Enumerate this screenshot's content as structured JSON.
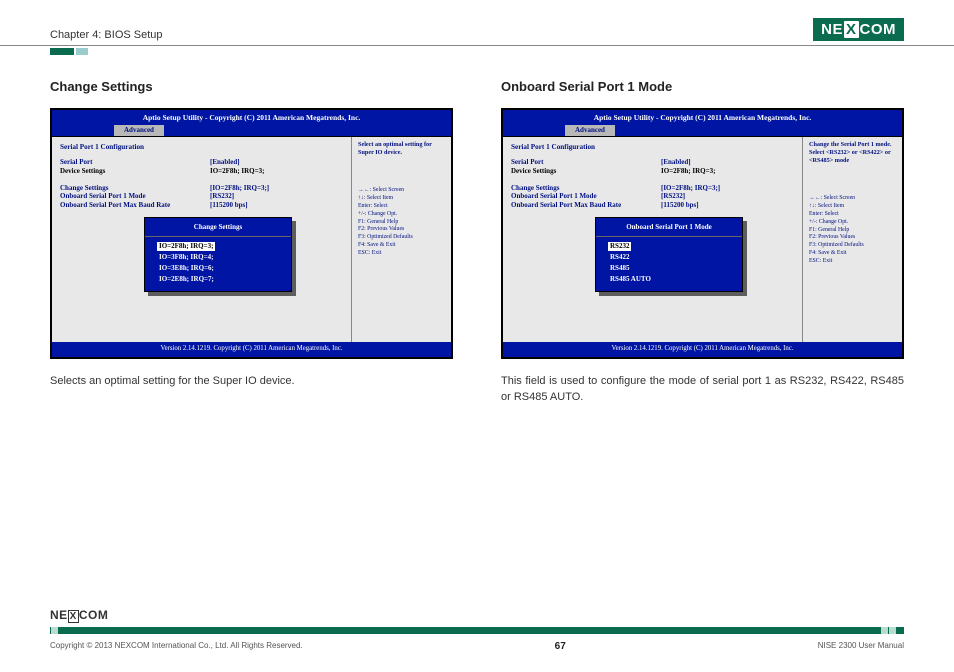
{
  "header": {
    "chapter": "Chapter 4: BIOS Setup",
    "logo_text_pre": "NE",
    "logo_text_x": "X",
    "logo_text_post": "COM"
  },
  "left": {
    "heading": "Change Settings",
    "bios": {
      "title": "Aptio Setup Utility - Copyright (C) 2011 American Megatrends, Inc.",
      "tab": "Advanced",
      "config_header": "Serial Port 1 Configuration",
      "rows": [
        {
          "label": "Serial Port",
          "value": "[Enabled]",
          "cls": "blue"
        },
        {
          "label": "Device Settings",
          "value": "IO=2F8h; IRQ=3;",
          "cls": "black"
        }
      ],
      "rows2": [
        {
          "label": "Change Settings",
          "value": "[IO=2F8h; IRQ=3;]",
          "cls": "blue"
        },
        {
          "label": "Onboard Serial Port 1 Mode",
          "value": "[RS232]",
          "cls": "blue"
        },
        {
          "label": "Onboard Serial Port Max Baud Rate",
          "value": "[115200 bps]",
          "cls": "blue"
        }
      ],
      "help_top": "Select an optimal setting for Super IO device.",
      "popup_title": "Change Settings",
      "popup_items": [
        "IO=2F8h; IRQ=3;",
        "IO=3F8h; IRQ=4;",
        "IO=3E8h; IRQ=6;",
        "IO=2E8h; IRQ=7;"
      ],
      "popup_selected_index": 0,
      "keyhelp": [
        "→←: Select Screen",
        "↑↓: Select Item",
        "Enter: Select",
        "+/-: Change Opt.",
        "F1: General Help",
        "F2: Previous Values",
        "F3: Optimized Defaults",
        "F4: Save & Exit",
        "ESC: Exit"
      ],
      "footer": "Version 2.14.1219. Copyright (C) 2011 American Megatrends, Inc."
    },
    "caption": "Selects an optimal setting for the Super IO device."
  },
  "right": {
    "heading": "Onboard Serial Port 1 Mode",
    "bios": {
      "title": "Aptio Setup Utility - Copyright (C) 2011 American Megatrends, Inc.",
      "tab": "Advanced",
      "config_header": "Serial Port 1 Configuration",
      "rows": [
        {
          "label": "Serial Port",
          "value": "[Enabled]",
          "cls": "blue"
        },
        {
          "label": "Device Settings",
          "value": "IO=2F8h; IRQ=3;",
          "cls": "black"
        }
      ],
      "rows2": [
        {
          "label": "Change Settings",
          "value": "[IO=2F8h; IRQ=3;]",
          "cls": "blue"
        },
        {
          "label": "Onboard Serial Port 1 Mode",
          "value": "[RS232]",
          "cls": "blue"
        },
        {
          "label": "Onboard Serial Port Max Baud Rate",
          "value": "[115200 bps]",
          "cls": "blue"
        }
      ],
      "help_top": "Change the Serial Port 1 mode. Select <RS232> or <RS422> or <RS485> mode",
      "popup_title": "Onboard Serial Port 1 Mode",
      "popup_items": [
        "RS232",
        "RS422",
        "RS485",
        "RS485 AUTO"
      ],
      "popup_selected_index": 0,
      "keyhelp": [
        "→←: Select Screen",
        "↑↓: Select Item",
        "Enter: Select",
        "+/-: Change Opt.",
        "F1: General Help",
        "F2: Previous Values",
        "F3: Optimized Defaults",
        "F4: Save & Exit",
        "ESC: Exit"
      ],
      "footer": "Version 2.14.1219. Copyright (C) 2011 American Megatrends, Inc."
    },
    "caption": "This field is used to configure the mode of serial port 1 as RS232, RS422, RS485 or RS485 AUTO."
  },
  "footer": {
    "copyright": "Copyright © 2013 NEXCOM International Co., Ltd. All Rights Reserved.",
    "page": "67",
    "manual": "NISE 2300 User Manual",
    "logo": "NEXCOM"
  }
}
